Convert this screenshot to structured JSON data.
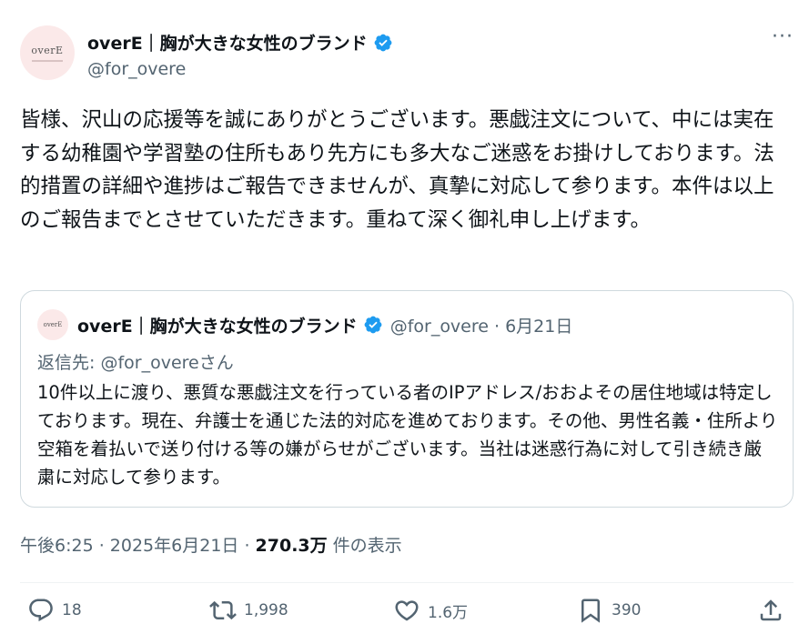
{
  "author": {
    "avatar_text": "overE",
    "display_name": "overE｜胸が大きな女性のブランド",
    "handle": "@for_overe",
    "verified": true
  },
  "icons": {
    "more": "more-icon",
    "verified": "verified-badge-icon",
    "reply": "reply-icon",
    "retweet": "retweet-icon",
    "like": "heart-icon",
    "bookmark": "bookmark-icon",
    "share": "share-icon"
  },
  "more_label": "···",
  "tweet": {
    "text": "皆様、沢山の応援等を誠にありがとうございます。悪戯注文について、中には実在する幼稚園や学習塾の住所もあり先方にも多大なご迷惑をお掛けしております。法的措置の詳細や進捗はご報告できませんが、真摯に対応して参ります。本件は以上のご報告までとさせていただきます。重ねて深く御礼申し上げます。"
  },
  "quote": {
    "avatar_text": "overE",
    "display_name": "overE｜胸が大きな女性のブランド",
    "handle_date": "@for_overe · 6月21日",
    "reply_prefix": "返信先: ",
    "reply_handle": "@for_overeさん",
    "text": "10件以上に渡り、悪質な悪戯注文を行っている者のIPアドレス/おおよその居住地域は特定しております。現在、弁護士を通じた法的対応を進めております。その他、男性名義・住所より空箱を着払いで送り付ける等の嫌がらせがございます。当社は迷惑行為に対して引き続き厳粛に対応して参ります。"
  },
  "meta": {
    "timestamp": "午後6:25 · 2025年6月21日 · ",
    "views_count": "270.3万",
    "views_label": " 件の表示"
  },
  "actions": {
    "replies": "18",
    "retweets": "1,998",
    "likes": "1.6万",
    "bookmarks": "390"
  },
  "colors": {
    "accent": "#1d9bf0",
    "muted": "#536471",
    "text": "#0f1419",
    "border": "#cfd9de"
  }
}
